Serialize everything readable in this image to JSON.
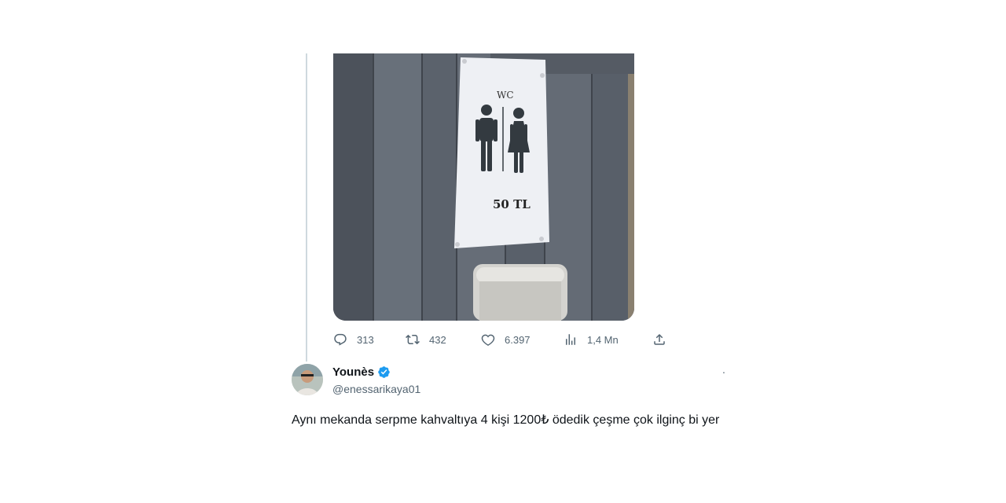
{
  "media": {
    "sign_title": "WC",
    "sign_price": "50 TL"
  },
  "actions": {
    "reply_count": "313",
    "retweet_count": "432",
    "like_count": "6.397",
    "view_count": "1,4 Mn"
  },
  "reply": {
    "author_name": "Younès",
    "author_handle": "@enessarikaya01",
    "text": "Aynı mekanda serpme kahvaltıya 4 kişi 1200₺ ödedik çeşme çok ilginç bi yer"
  },
  "icons": {
    "reply": "speech-bubble-icon",
    "retweet": "retweet-icon",
    "like": "heart-icon",
    "views": "bar-chart-icon",
    "share": "share-icon",
    "verified": "verified-badge-icon",
    "more": "more-dots-icon"
  },
  "colors": {
    "verified": "#1d9bf0",
    "muted": "#536471",
    "thread_line": "#cfd9de"
  }
}
